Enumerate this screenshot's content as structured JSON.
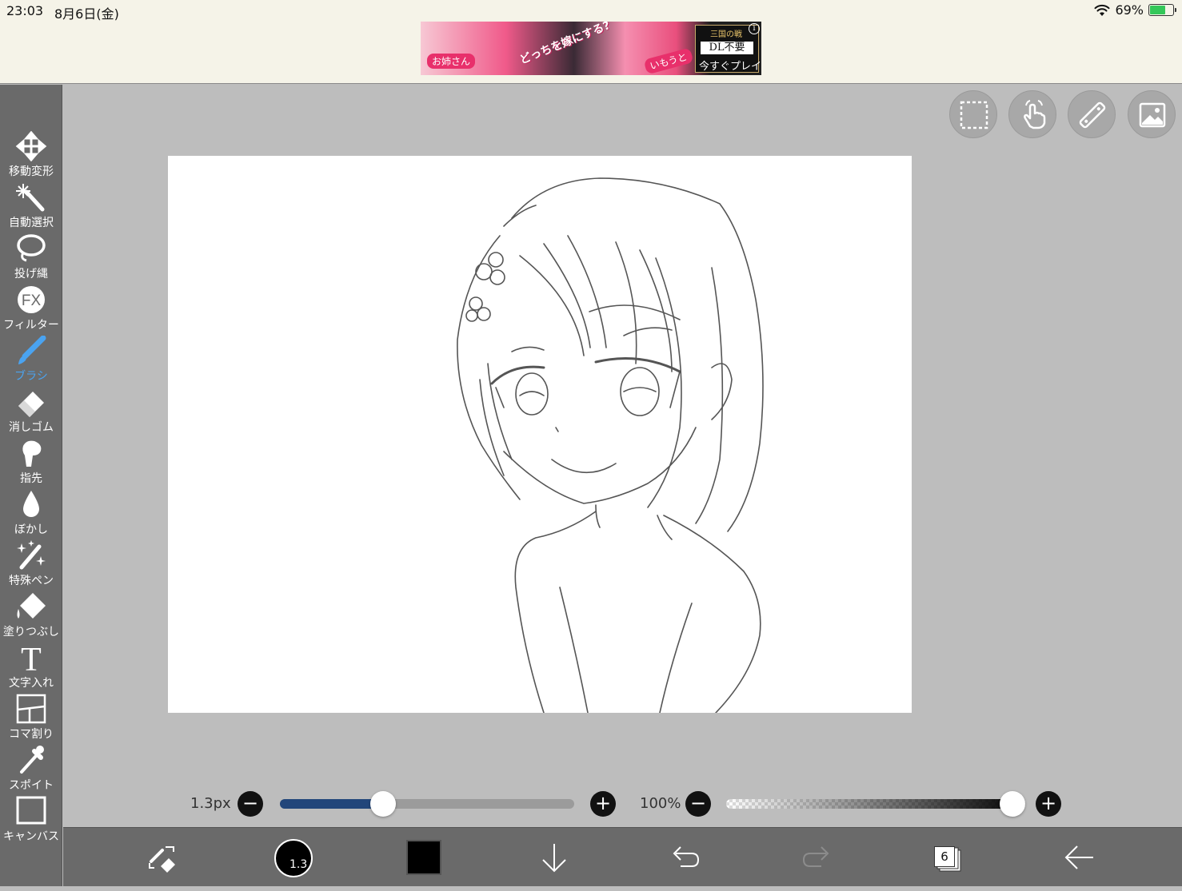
{
  "status_bar": {
    "time": "23:03",
    "date": "8月6日(金)",
    "battery_percent": "69%",
    "battery_level": 0.69,
    "wifi_icon": "wifi-icon"
  },
  "ad": {
    "label_left": "お姉さん",
    "headline": "どっちを嫁にする?",
    "label_right": "いもうと",
    "logo": "三国の戦",
    "dl": "DL不要",
    "play": "今すぐプレイ!",
    "info": "i"
  },
  "tools": [
    {
      "label": "移動変形",
      "icon": "move-transform-icon"
    },
    {
      "label": "自動選択",
      "icon": "magic-wand-icon"
    },
    {
      "label": "投げ縄",
      "icon": "lasso-icon"
    },
    {
      "label": "フィルター",
      "icon": "filter-fx-icon",
      "glyph": "FX"
    },
    {
      "label": "ブラシ",
      "icon": "brush-icon",
      "active": true
    },
    {
      "label": "消しゴム",
      "icon": "eraser-icon"
    },
    {
      "label": "指先",
      "icon": "finger-smudge-icon"
    },
    {
      "label": "ぼかし",
      "icon": "blur-drop-icon"
    },
    {
      "label": "特殊ペン",
      "icon": "special-pen-icon"
    },
    {
      "label": "塗りつぶし",
      "icon": "fill-bucket-icon"
    },
    {
      "label": "文字入れ",
      "icon": "text-icon",
      "glyph": "T"
    },
    {
      "label": "コマ割り",
      "icon": "panel-divide-icon"
    },
    {
      "label": "スポイト",
      "icon": "eyedropper-icon"
    },
    {
      "label": "キャンバス",
      "icon": "canvas-icon"
    }
  ],
  "top_actions": [
    {
      "icon": "selection-icon"
    },
    {
      "icon": "hand-gesture-icon"
    },
    {
      "icon": "ruler-icon"
    },
    {
      "icon": "image-material-icon"
    }
  ],
  "brush_size": {
    "label": "1.3px",
    "level": 0.35,
    "minus": "−",
    "plus": "+"
  },
  "opacity": {
    "label": "100%",
    "level": 1.0,
    "minus": "−",
    "plus": "+"
  },
  "bottom_bar": {
    "brush_size_text": "1.3",
    "color_hex": "#000000",
    "layer_count": "6",
    "icons": [
      "swap-tools-icon",
      "brush-size-icon",
      "color-icon",
      "download-icon",
      "undo-icon",
      "redo-icon",
      "layers-icon",
      "back-arrow-icon"
    ]
  },
  "colors": {
    "toolbar_bg": "#6a6a6a",
    "workspace_bg": "#bdbdbd",
    "active_tool": "#4aa3f0",
    "slider_fill": "#22467a"
  }
}
